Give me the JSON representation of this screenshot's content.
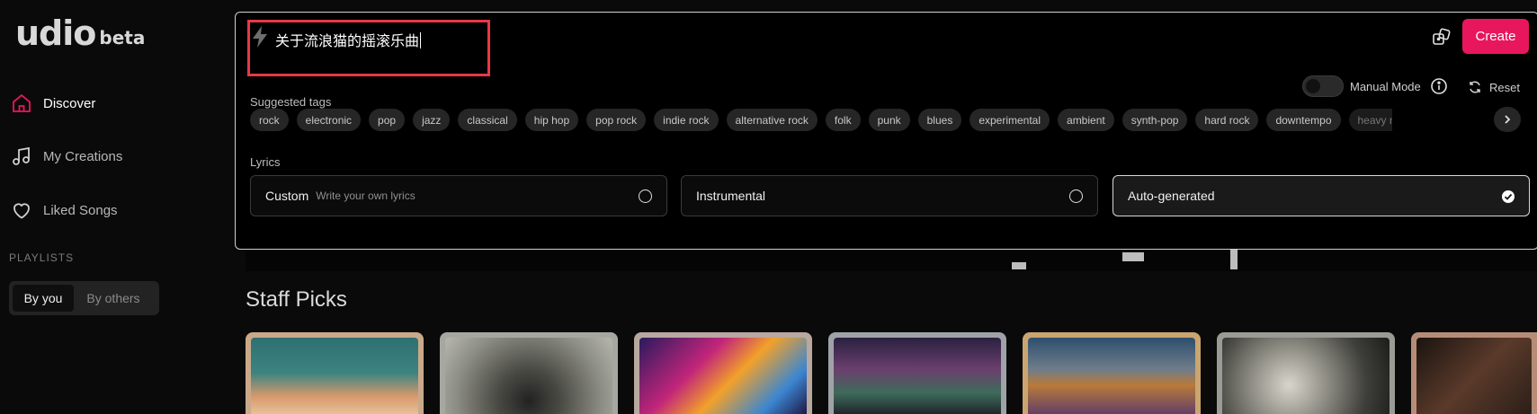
{
  "app": {
    "logo": "udio",
    "badge": "beta"
  },
  "sidebar": {
    "items": [
      {
        "label": "Discover",
        "icon": "home-icon"
      },
      {
        "label": "My Creations",
        "icon": "music-note-icon"
      },
      {
        "label": "Liked Songs",
        "icon": "heart-icon"
      }
    ],
    "playlists_label": "PLAYLISTS",
    "playlist_tabs": [
      "By you",
      "By others"
    ]
  },
  "create": {
    "prompt": "关于流浪猫的摇滚乐曲",
    "create_label": "Create",
    "manual_mode_label": "Manual Mode",
    "reset_label": "Reset",
    "suggested_tags_label": "Suggested tags",
    "tags": [
      "rock",
      "electronic",
      "pop",
      "jazz",
      "classical",
      "hip hop",
      "pop rock",
      "indie rock",
      "alternative rock",
      "folk",
      "punk",
      "blues",
      "experimental",
      "ambient",
      "synth-pop",
      "hard rock",
      "downtempo",
      "heavy metal"
    ],
    "lyrics_label": "Lyrics",
    "lyrics_options": [
      {
        "title": "Custom",
        "subtitle": "Write your own lyrics"
      },
      {
        "title": "Instrumental",
        "subtitle": ""
      },
      {
        "title": "Auto-generated",
        "subtitle": ""
      }
    ]
  },
  "main": {
    "staff_picks_title": "Staff Picks"
  },
  "colors": {
    "accent": "#e8175d",
    "highlight_box": "#e63946",
    "background": "#0a0a0a"
  }
}
